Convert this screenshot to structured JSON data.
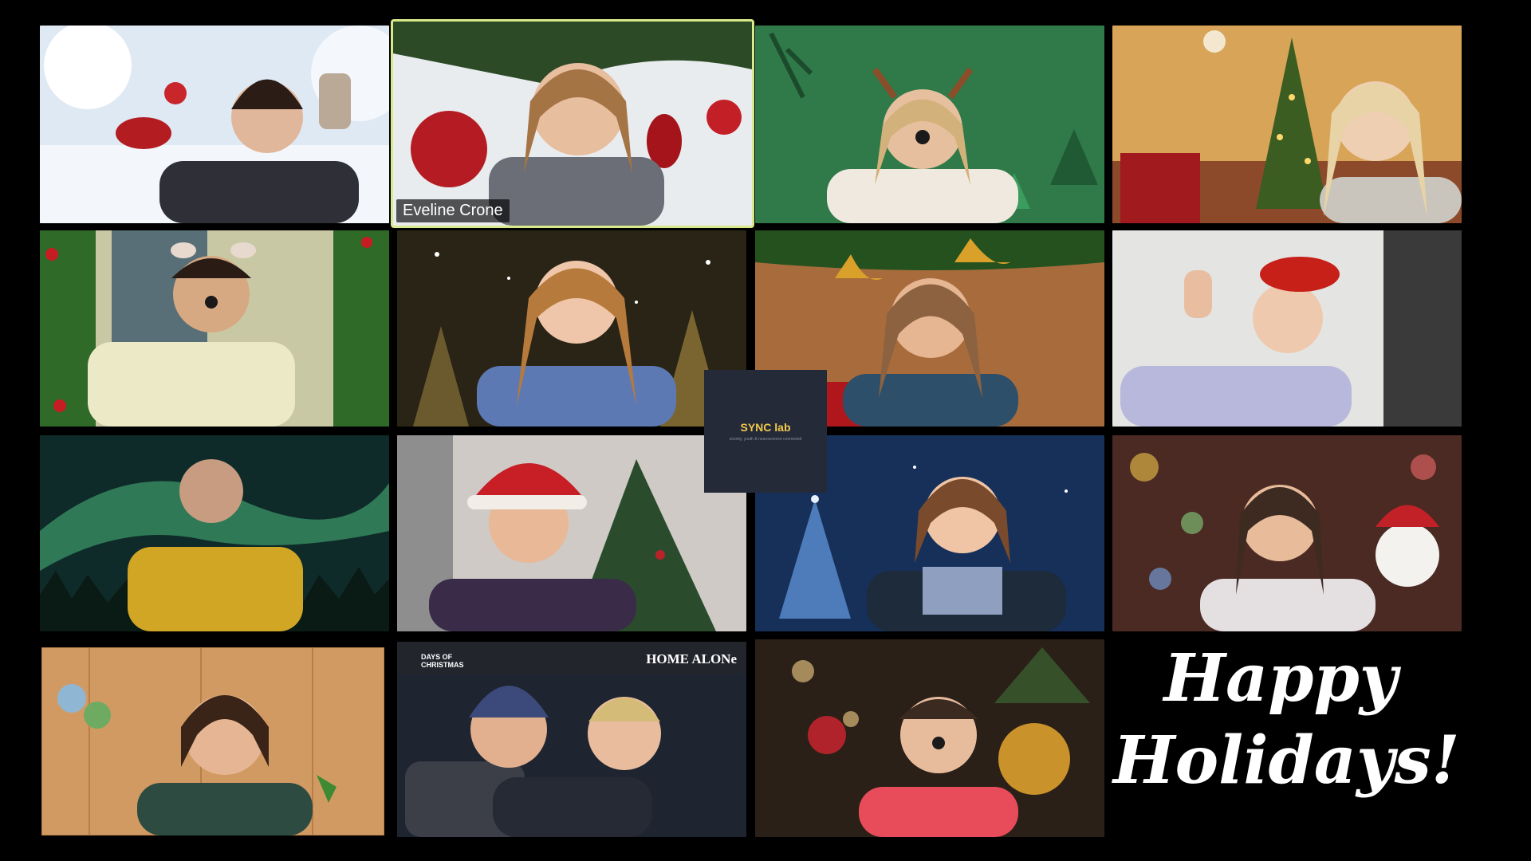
{
  "meeting": {
    "active_speaker": "Eveline Crone",
    "logo": {
      "brand": "SYNC lab",
      "tagline": "society, youth & neuroscience connected"
    },
    "greeting": {
      "line1": "Happy",
      "line2": "Holidays!"
    }
  },
  "participants": [
    {
      "background": "snow-santa-reindeer"
    },
    {
      "background": "christmas-ornaments",
      "name_label": "Eveline Crone",
      "active": true
    },
    {
      "background": "green-reindeer-filter"
    },
    {
      "background": "living-room-tree"
    },
    {
      "background": "garland-frame"
    },
    {
      "background": "snowy-forest-night"
    },
    {
      "background": "wood-bells"
    },
    {
      "background": "bright-room"
    },
    {
      "background": "northern-lights"
    },
    {
      "background": "santa-hat-tree"
    },
    {
      "background": "blue-sparkle-tree"
    },
    {
      "background": "bokeh-snowman"
    },
    {
      "background": "wood-ornaments"
    },
    {
      "background": "home-alone-poster",
      "poster_left": "DAYS OF CHRISTMAS",
      "poster_right": "HOME ALONe"
    },
    {
      "background": "bokeh-reindeer"
    }
  ],
  "colors": {
    "active_border": "#d7e98a",
    "logo_bg": "#252a38",
    "logo_accent": "#f2c94c"
  }
}
